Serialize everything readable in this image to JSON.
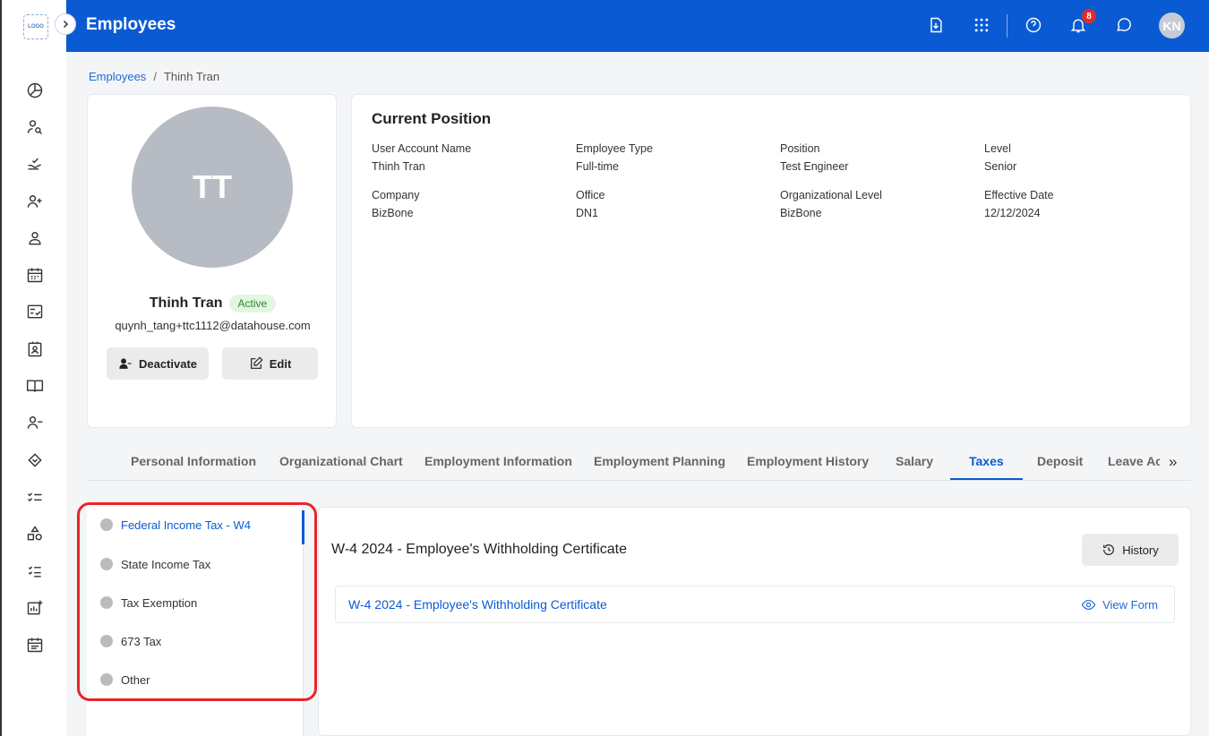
{
  "sidebar": {
    "logo_text": "LOGO",
    "items": [
      {
        "icon": "dashboard-icon"
      },
      {
        "icon": "user-search-icon"
      },
      {
        "icon": "approval-icon"
      },
      {
        "icon": "add-user-icon"
      },
      {
        "icon": "user-icon"
      },
      {
        "icon": "calendar-icon"
      },
      {
        "icon": "checklist-icon"
      },
      {
        "icon": "contact-card-icon"
      },
      {
        "icon": "book-icon"
      },
      {
        "icon": "remove-user-icon"
      },
      {
        "icon": "handshake-icon"
      },
      {
        "icon": "task-list-icon"
      },
      {
        "icon": "shapes-icon"
      },
      {
        "icon": "list-icon"
      },
      {
        "icon": "report-icon"
      },
      {
        "icon": "schedule-icon"
      }
    ]
  },
  "header": {
    "title": "Employees",
    "notification_count": "8",
    "user_initials": "KN"
  },
  "breadcrumb": {
    "parent": "Employees",
    "separator": "/",
    "current": "Thinh Tran"
  },
  "profile": {
    "initials": "TT",
    "name": "Thinh Tran",
    "status": "Active",
    "email": "quynh_tang+ttc1112@datahouse.com",
    "deactivate_label": "Deactivate",
    "edit_label": "Edit"
  },
  "position": {
    "title": "Current Position",
    "fields": [
      {
        "label": "User Account Name",
        "value": "Thinh Tran"
      },
      {
        "label": "Employee Type",
        "value": "Full-time"
      },
      {
        "label": "Position",
        "value": "Test Engineer"
      },
      {
        "label": "Level",
        "value": "Senior"
      },
      {
        "label": "Company",
        "value": "BizBone"
      },
      {
        "label": "Office",
        "value": "DN1"
      },
      {
        "label": "Organizational Level",
        "value": "BizBone"
      },
      {
        "label": "Effective Date",
        "value": "12/12/2024"
      }
    ]
  },
  "tabs": {
    "items": [
      "Personal Information",
      "Organizational Chart",
      "Employment Information",
      "Employment Planning",
      "Employment History",
      "Salary",
      "Taxes",
      "Deposit",
      "Leave Ac"
    ],
    "active": "Taxes",
    "more_glyph": "»"
  },
  "tax_menu": {
    "items": [
      "Federal Income Tax - W4",
      "State Income Tax",
      "Tax Exemption",
      "673 Tax",
      "Other"
    ],
    "active": "Federal Income Tax - W4"
  },
  "form": {
    "title": "W-4 2024 - Employee's Withholding Certificate",
    "history_label": "History",
    "row_link": "W-4 2024 - Employee's Withholding Certificate",
    "view_label": "View Form"
  },
  "colors": {
    "header_bg": "#0a5bd3",
    "accent": "#0a5bd3",
    "highlight": "#e5262b",
    "active_badge_bg": "#e3f6e0"
  }
}
